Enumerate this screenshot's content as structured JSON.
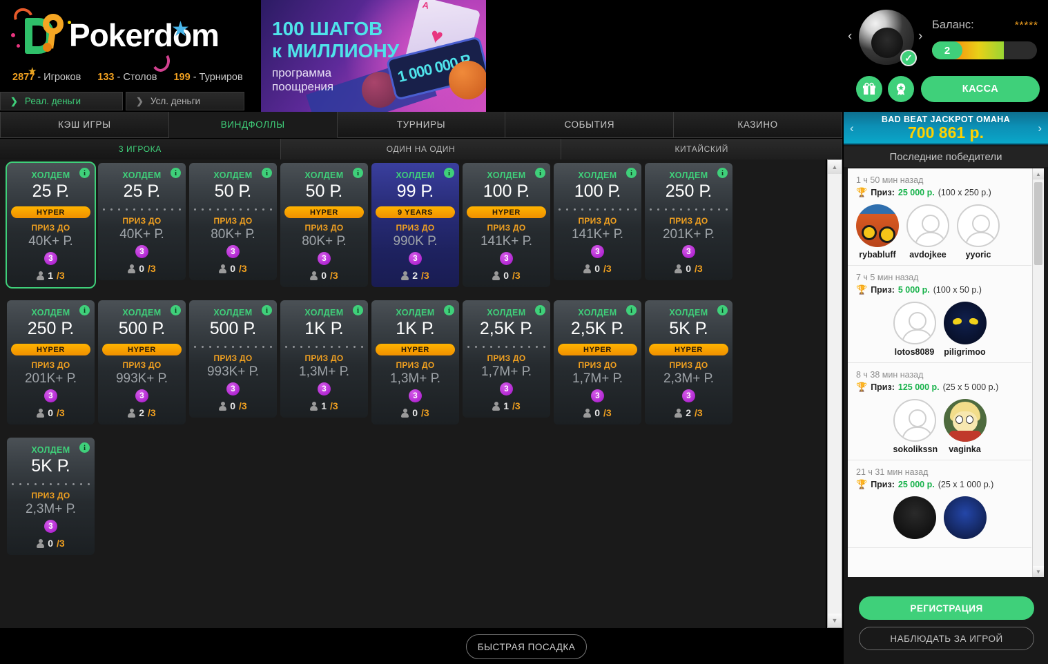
{
  "brand": {
    "name": "Pokerdom"
  },
  "stats": [
    {
      "value": "2877",
      "label": "- Игроков"
    },
    {
      "value": "133",
      "label": "- Столов"
    },
    {
      "value": "199",
      "label": "- Турниров"
    }
  ],
  "money_tabs": [
    {
      "label": "Реал. деньги",
      "active": true
    },
    {
      "label": "Усл. деньги",
      "active": false
    }
  ],
  "banner": {
    "line1": "100 ШАГОВ",
    "line2": "к МИЛЛИОНУ",
    "line3": "программа\nпоощрения",
    "prize": "1 000 000 Р",
    "card_rank": "A"
  },
  "account": {
    "balance_label": "Баланс:",
    "balance_value": "*****",
    "level": "2",
    "cassa_label": "КАССА",
    "prev_avatar": "‹",
    "next_avatar": "›",
    "gift_icon": "gift-icon",
    "badge_icon": "award-icon"
  },
  "nav_tabs": [
    {
      "label": "КЭШ ИГРЫ",
      "active": false
    },
    {
      "label": "ВИНДФОЛЛЫ",
      "active": true
    },
    {
      "label": "ТУРНИРЫ",
      "active": false
    },
    {
      "label": "СОБЫТИЯ",
      "active": false
    },
    {
      "label": "КАЗИНО",
      "active": false
    }
  ],
  "sub_tabs": [
    {
      "label": "3 ИГРОКА",
      "active": true
    },
    {
      "label": "ОДИН НА ОДИН",
      "active": false
    },
    {
      "label": "КИТАЙСКИЙ",
      "active": false
    }
  ],
  "card_labels": {
    "prize_to": "ПРИЗ ДО",
    "game_type": "ХОЛДЕМ",
    "hyper": "HYPER",
    "info": "i"
  },
  "tables": [
    {
      "game": "ХОЛДЕМ",
      "stake": "25 Р.",
      "badge": "HYPER",
      "badge_type": "hyper",
      "prize_label": "ПРИЗ ДО",
      "prize": "40K+ Р.",
      "seats": "3",
      "players": "1",
      "max": "3",
      "selected": true,
      "special": false
    },
    {
      "game": "ХОЛДЕМ",
      "stake": "25 Р.",
      "badge": "",
      "badge_type": "dots",
      "prize_label": "ПРИЗ ДО",
      "prize": "40K+ Р.",
      "seats": "3",
      "players": "0",
      "max": "3",
      "selected": false,
      "special": false
    },
    {
      "game": "ХОЛДЕМ",
      "stake": "50 Р.",
      "badge": "",
      "badge_type": "dots",
      "prize_label": "ПРИЗ ДО",
      "prize": "80K+ Р.",
      "seats": "3",
      "players": "0",
      "max": "3",
      "selected": false,
      "special": false
    },
    {
      "game": "ХОЛДЕМ",
      "stake": "50 Р.",
      "badge": "HYPER",
      "badge_type": "hyper",
      "prize_label": "ПРИЗ ДО",
      "prize": "80K+ Р.",
      "seats": "3",
      "players": "0",
      "max": "3",
      "selected": false,
      "special": false
    },
    {
      "game": "ХОЛДЕМ",
      "stake": "99 Р.",
      "badge": "9 YEARS",
      "badge_type": "hyper",
      "prize_label": "ПРИЗ ДО",
      "prize": "990K Р.",
      "seats": "3",
      "players": "2",
      "max": "3",
      "selected": false,
      "special": true
    },
    {
      "game": "ХОЛДЕМ",
      "stake": "100 Р.",
      "badge": "HYPER",
      "badge_type": "hyper",
      "prize_label": "ПРИЗ ДО",
      "prize": "141K+ Р.",
      "seats": "3",
      "players": "0",
      "max": "3",
      "selected": false,
      "special": false
    },
    {
      "game": "ХОЛДЕМ",
      "stake": "100 Р.",
      "badge": "",
      "badge_type": "dots",
      "prize_label": "ПРИЗ ДО",
      "prize": "141K+ Р.",
      "seats": "3",
      "players": "0",
      "max": "3",
      "selected": false,
      "special": false
    },
    {
      "game": "ХОЛДЕМ",
      "stake": "250 Р.",
      "badge": "",
      "badge_type": "dots",
      "prize_label": "ПРИЗ ДО",
      "prize": "201K+ Р.",
      "seats": "3",
      "players": "0",
      "max": "3",
      "selected": false,
      "special": false
    },
    {
      "game": "ХОЛДЕМ",
      "stake": "250 Р.",
      "badge": "HYPER",
      "badge_type": "hyper",
      "prize_label": "ПРИЗ ДО",
      "prize": "201K+ Р.",
      "seats": "3",
      "players": "0",
      "max": "3",
      "selected": false,
      "special": false
    },
    {
      "game": "ХОЛДЕМ",
      "stake": "500 Р.",
      "badge": "HYPER",
      "badge_type": "hyper",
      "prize_label": "ПРИЗ ДО",
      "prize": "993K+ Р.",
      "seats": "3",
      "players": "2",
      "max": "3",
      "selected": false,
      "special": false
    },
    {
      "game": "ХОЛДЕМ",
      "stake": "500 Р.",
      "badge": "",
      "badge_type": "dots",
      "prize_label": "ПРИЗ ДО",
      "prize": "993K+ Р.",
      "seats": "3",
      "players": "0",
      "max": "3",
      "selected": false,
      "special": false
    },
    {
      "game": "ХОЛДЕМ",
      "stake": "1K Р.",
      "badge": "",
      "badge_type": "dots",
      "prize_label": "ПРИЗ ДО",
      "prize": "1,3M+ Р.",
      "seats": "3",
      "players": "1",
      "max": "3",
      "selected": false,
      "special": false
    },
    {
      "game": "ХОЛДЕМ",
      "stake": "1K Р.",
      "badge": "HYPER",
      "badge_type": "hyper",
      "prize_label": "ПРИЗ ДО",
      "prize": "1,3M+ Р.",
      "seats": "3",
      "players": "0",
      "max": "3",
      "selected": false,
      "special": false
    },
    {
      "game": "ХОЛДЕМ",
      "stake": "2,5K Р.",
      "badge": "",
      "badge_type": "dots",
      "prize_label": "ПРИЗ ДО",
      "prize": "1,7M+ Р.",
      "seats": "3",
      "players": "1",
      "max": "3",
      "selected": false,
      "special": false
    },
    {
      "game": "ХОЛДЕМ",
      "stake": "2,5K Р.",
      "badge": "HYPER",
      "badge_type": "hyper",
      "prize_label": "ПРИЗ ДО",
      "prize": "1,7M+ Р.",
      "seats": "3",
      "players": "0",
      "max": "3",
      "selected": false,
      "special": false
    },
    {
      "game": "ХОЛДЕМ",
      "stake": "5K Р.",
      "badge": "HYPER",
      "badge_type": "hyper",
      "prize_label": "ПРИЗ ДО",
      "prize": "2,3M+ Р.",
      "seats": "3",
      "players": "2",
      "max": "3",
      "selected": false,
      "special": false
    },
    {
      "game": "ХОЛДЕМ",
      "stake": "5K Р.",
      "badge": "",
      "badge_type": "dots",
      "prize_label": "ПРИЗ ДО",
      "prize": "2,3M+ Р.",
      "seats": "3",
      "players": "0",
      "max": "3",
      "selected": false,
      "special": false
    }
  ],
  "fast_seat": {
    "label": "БЫСТРАЯ ПОСАДКА"
  },
  "jackpot": {
    "title": "BAD BEAT JACKPOT ОМАНА",
    "amount": "700 861 p.",
    "prev": "‹",
    "next": "›"
  },
  "winners": {
    "header": "Последние победители",
    "prize_word": "Приз:",
    "entries": [
      {
        "time": "1 ч 50 мин назад",
        "amount": "25 000 p.",
        "multiplier": "(100 x 250 p.)",
        "center": false,
        "players": [
          {
            "name": "rybabluff",
            "avatar": "fish"
          },
          {
            "name": "avdojkee",
            "avatar": "placeholder"
          },
          {
            "name": "yyoric",
            "avatar": "placeholder"
          }
        ]
      },
      {
        "time": "7 ч 5 мин назад",
        "amount": "5 000 p.",
        "multiplier": "(100 x 50 p.)",
        "center": true,
        "players": [
          {
            "name": "lotos8089",
            "avatar": "placeholder"
          },
          {
            "name": "piligrimoo",
            "avatar": "owl"
          }
        ]
      },
      {
        "time": "8 ч 38 мин назад",
        "amount": "125 000 p.",
        "multiplier": "(25 x 5 000 p.)",
        "center": true,
        "players": [
          {
            "name": "sokolikssn",
            "avatar": "placeholder"
          },
          {
            "name": "vaginka",
            "avatar": "cartoon"
          }
        ]
      },
      {
        "time": "21 ч 31 мин назад",
        "amount": "25 000 p.",
        "multiplier": "(25 x 1 000 p.)",
        "center": true,
        "players": [
          {
            "name": "",
            "avatar": "dark"
          },
          {
            "name": "",
            "avatar": "blue"
          }
        ]
      }
    ]
  },
  "side_buttons": {
    "register": "РЕГИСТРАЦИЯ",
    "watch": "НАБЛЮДАТЬ ЗА ИГРОЙ"
  }
}
